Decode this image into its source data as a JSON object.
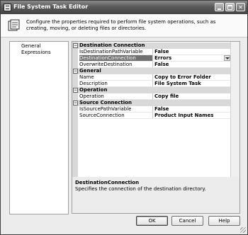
{
  "window": {
    "title": "File System Task Editor",
    "description": "Configure the properties required to perform file system operations, such as creating, moving, or deleting files or directories."
  },
  "nav": {
    "items": [
      {
        "label": "General",
        "selected": true
      },
      {
        "label": "Expressions",
        "selected": false
      }
    ]
  },
  "grid": {
    "categories": [
      {
        "label": "Destination Connection",
        "properties": [
          {
            "name": "IsDestinationPathVariable",
            "value": "False"
          },
          {
            "name": "DestinationConnection",
            "value": "Errors"
          },
          {
            "name": "OverwriteDestination",
            "value": "False"
          }
        ]
      },
      {
        "label": "General",
        "properties": [
          {
            "name": "Name",
            "value": "Copy to Error Folder"
          },
          {
            "name": "Description",
            "value": "File System Task"
          }
        ]
      },
      {
        "label": "Operation",
        "properties": [
          {
            "name": "Operation",
            "value": "Copy file"
          }
        ]
      },
      {
        "label": "Source Connection",
        "properties": [
          {
            "name": "IsSourcePathVariable",
            "value": "False"
          },
          {
            "name": "SourceConnection",
            "value": "Product Input Names"
          }
        ]
      }
    ],
    "collapse_symbol": "−"
  },
  "description_pane": {
    "title": "DestinationConnection",
    "text": "Specifies the connection of the destination directory."
  },
  "buttons": {
    "ok": "OK",
    "cancel": "Cancel",
    "help": "Help"
  },
  "titlebar_buttons": {
    "close": "✕"
  }
}
